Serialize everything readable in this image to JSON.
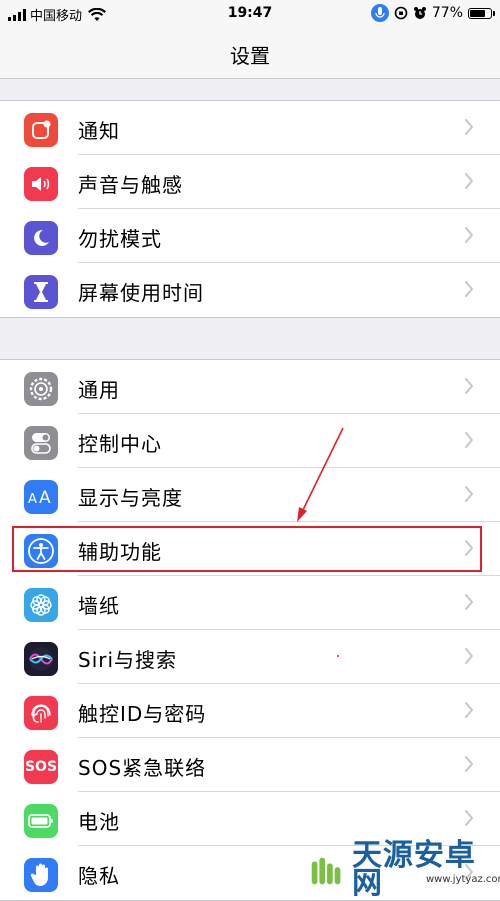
{
  "status_bar": {
    "carrier": "中国移动",
    "time": "19:47",
    "battery": "77%",
    "battery_level": 0.77
  },
  "nav": {
    "title": "设置"
  },
  "groups": [
    [
      {
        "label": "通知",
        "icon": "notifications-icon",
        "color": "#f04a3a"
      },
      {
        "label": "声音与触感",
        "icon": "sounds-icon",
        "color": "#f2394f"
      },
      {
        "label": "勿扰模式",
        "icon": "moon-icon",
        "color": "#5b55d4"
      },
      {
        "label": "屏幕使用时间",
        "icon": "hourglass-icon",
        "color": "#5b55d4"
      }
    ],
    [
      {
        "label": "通用",
        "icon": "gear-icon",
        "color": "#8e8e93"
      },
      {
        "label": "控制中心",
        "icon": "toggles-icon",
        "color": "#8e8e93"
      },
      {
        "label": "显示与亮度",
        "icon": "text-size-icon",
        "color": "#2f7cf6"
      },
      {
        "label": "辅助功能",
        "icon": "accessibility-icon",
        "color": "#2f7cf6"
      },
      {
        "label": "墙纸",
        "icon": "wallpaper-icon",
        "color": "#37a6e6"
      },
      {
        "label": "Siri与搜索",
        "icon": "siri-icon",
        "color": "#1c1c2e"
      },
      {
        "label": "触控ID与密码",
        "icon": "fingerprint-icon",
        "color": "#f2394f"
      },
      {
        "label": "SOS紧急联络",
        "icon": "sos-icon",
        "color": "#f2394f",
        "icon_text": "SOS"
      },
      {
        "label": "电池",
        "icon": "battery-icon",
        "color": "#4cd964"
      },
      {
        "label": "隐私",
        "icon": "hand-icon",
        "color": "#2f7cf6"
      }
    ]
  ],
  "watermark": {
    "brand": "天源安卓网",
    "url": "www.jytyaz.com"
  }
}
